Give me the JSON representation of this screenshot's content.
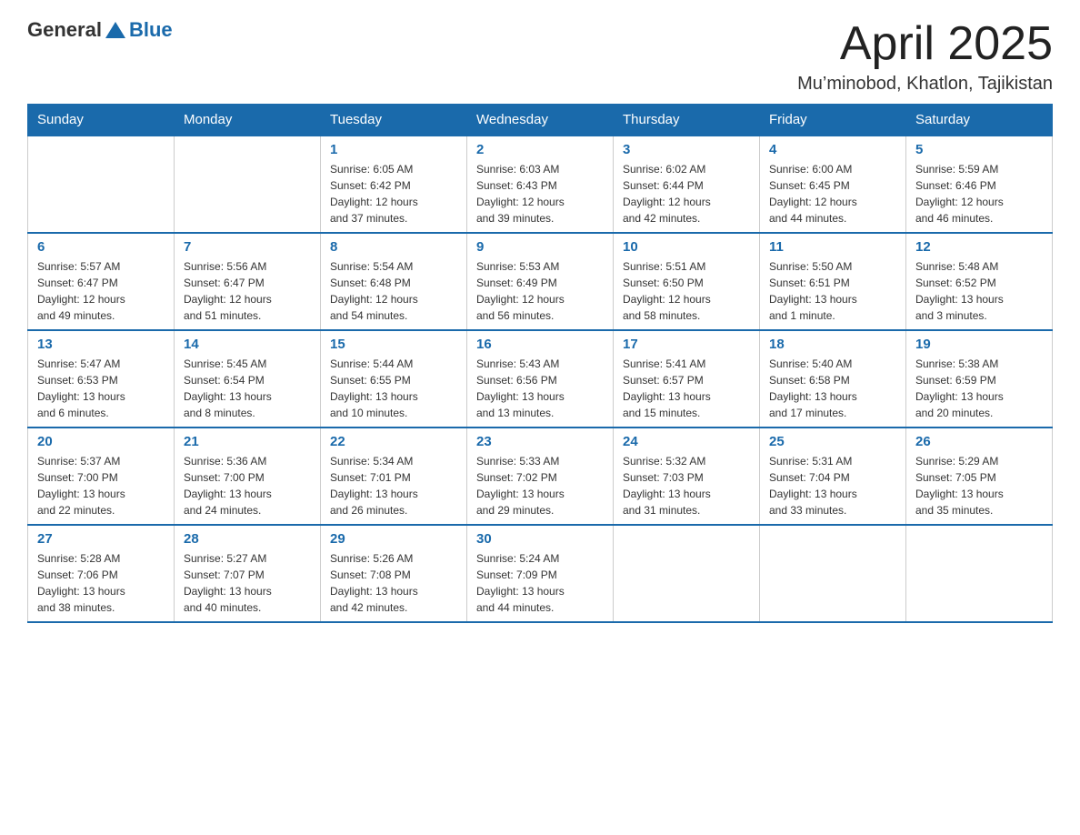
{
  "logo": {
    "general": "General",
    "blue": "Blue"
  },
  "title": "April 2025",
  "subtitle": "Mu’minobod, Khatlon, Tajikistan",
  "days_header": [
    "Sunday",
    "Monday",
    "Tuesday",
    "Wednesday",
    "Thursday",
    "Friday",
    "Saturday"
  ],
  "weeks": [
    [
      {
        "num": "",
        "info": ""
      },
      {
        "num": "",
        "info": ""
      },
      {
        "num": "1",
        "info": "Sunrise: 6:05 AM\nSunset: 6:42 PM\nDaylight: 12 hours\nand 37 minutes."
      },
      {
        "num": "2",
        "info": "Sunrise: 6:03 AM\nSunset: 6:43 PM\nDaylight: 12 hours\nand 39 minutes."
      },
      {
        "num": "3",
        "info": "Sunrise: 6:02 AM\nSunset: 6:44 PM\nDaylight: 12 hours\nand 42 minutes."
      },
      {
        "num": "4",
        "info": "Sunrise: 6:00 AM\nSunset: 6:45 PM\nDaylight: 12 hours\nand 44 minutes."
      },
      {
        "num": "5",
        "info": "Sunrise: 5:59 AM\nSunset: 6:46 PM\nDaylight: 12 hours\nand 46 minutes."
      }
    ],
    [
      {
        "num": "6",
        "info": "Sunrise: 5:57 AM\nSunset: 6:47 PM\nDaylight: 12 hours\nand 49 minutes."
      },
      {
        "num": "7",
        "info": "Sunrise: 5:56 AM\nSunset: 6:47 PM\nDaylight: 12 hours\nand 51 minutes."
      },
      {
        "num": "8",
        "info": "Sunrise: 5:54 AM\nSunset: 6:48 PM\nDaylight: 12 hours\nand 54 minutes."
      },
      {
        "num": "9",
        "info": "Sunrise: 5:53 AM\nSunset: 6:49 PM\nDaylight: 12 hours\nand 56 minutes."
      },
      {
        "num": "10",
        "info": "Sunrise: 5:51 AM\nSunset: 6:50 PM\nDaylight: 12 hours\nand 58 minutes."
      },
      {
        "num": "11",
        "info": "Sunrise: 5:50 AM\nSunset: 6:51 PM\nDaylight: 13 hours\nand 1 minute."
      },
      {
        "num": "12",
        "info": "Sunrise: 5:48 AM\nSunset: 6:52 PM\nDaylight: 13 hours\nand 3 minutes."
      }
    ],
    [
      {
        "num": "13",
        "info": "Sunrise: 5:47 AM\nSunset: 6:53 PM\nDaylight: 13 hours\nand 6 minutes."
      },
      {
        "num": "14",
        "info": "Sunrise: 5:45 AM\nSunset: 6:54 PM\nDaylight: 13 hours\nand 8 minutes."
      },
      {
        "num": "15",
        "info": "Sunrise: 5:44 AM\nSunset: 6:55 PM\nDaylight: 13 hours\nand 10 minutes."
      },
      {
        "num": "16",
        "info": "Sunrise: 5:43 AM\nSunset: 6:56 PM\nDaylight: 13 hours\nand 13 minutes."
      },
      {
        "num": "17",
        "info": "Sunrise: 5:41 AM\nSunset: 6:57 PM\nDaylight: 13 hours\nand 15 minutes."
      },
      {
        "num": "18",
        "info": "Sunrise: 5:40 AM\nSunset: 6:58 PM\nDaylight: 13 hours\nand 17 minutes."
      },
      {
        "num": "19",
        "info": "Sunrise: 5:38 AM\nSunset: 6:59 PM\nDaylight: 13 hours\nand 20 minutes."
      }
    ],
    [
      {
        "num": "20",
        "info": "Sunrise: 5:37 AM\nSunset: 7:00 PM\nDaylight: 13 hours\nand 22 minutes."
      },
      {
        "num": "21",
        "info": "Sunrise: 5:36 AM\nSunset: 7:00 PM\nDaylight: 13 hours\nand 24 minutes."
      },
      {
        "num": "22",
        "info": "Sunrise: 5:34 AM\nSunset: 7:01 PM\nDaylight: 13 hours\nand 26 minutes."
      },
      {
        "num": "23",
        "info": "Sunrise: 5:33 AM\nSunset: 7:02 PM\nDaylight: 13 hours\nand 29 minutes."
      },
      {
        "num": "24",
        "info": "Sunrise: 5:32 AM\nSunset: 7:03 PM\nDaylight: 13 hours\nand 31 minutes."
      },
      {
        "num": "25",
        "info": "Sunrise: 5:31 AM\nSunset: 7:04 PM\nDaylight: 13 hours\nand 33 minutes."
      },
      {
        "num": "26",
        "info": "Sunrise: 5:29 AM\nSunset: 7:05 PM\nDaylight: 13 hours\nand 35 minutes."
      }
    ],
    [
      {
        "num": "27",
        "info": "Sunrise: 5:28 AM\nSunset: 7:06 PM\nDaylight: 13 hours\nand 38 minutes."
      },
      {
        "num": "28",
        "info": "Sunrise: 5:27 AM\nSunset: 7:07 PM\nDaylight: 13 hours\nand 40 minutes."
      },
      {
        "num": "29",
        "info": "Sunrise: 5:26 AM\nSunset: 7:08 PM\nDaylight: 13 hours\nand 42 minutes."
      },
      {
        "num": "30",
        "info": "Sunrise: 5:24 AM\nSunset: 7:09 PM\nDaylight: 13 hours\nand 44 minutes."
      },
      {
        "num": "",
        "info": ""
      },
      {
        "num": "",
        "info": ""
      },
      {
        "num": "",
        "info": ""
      }
    ]
  ]
}
